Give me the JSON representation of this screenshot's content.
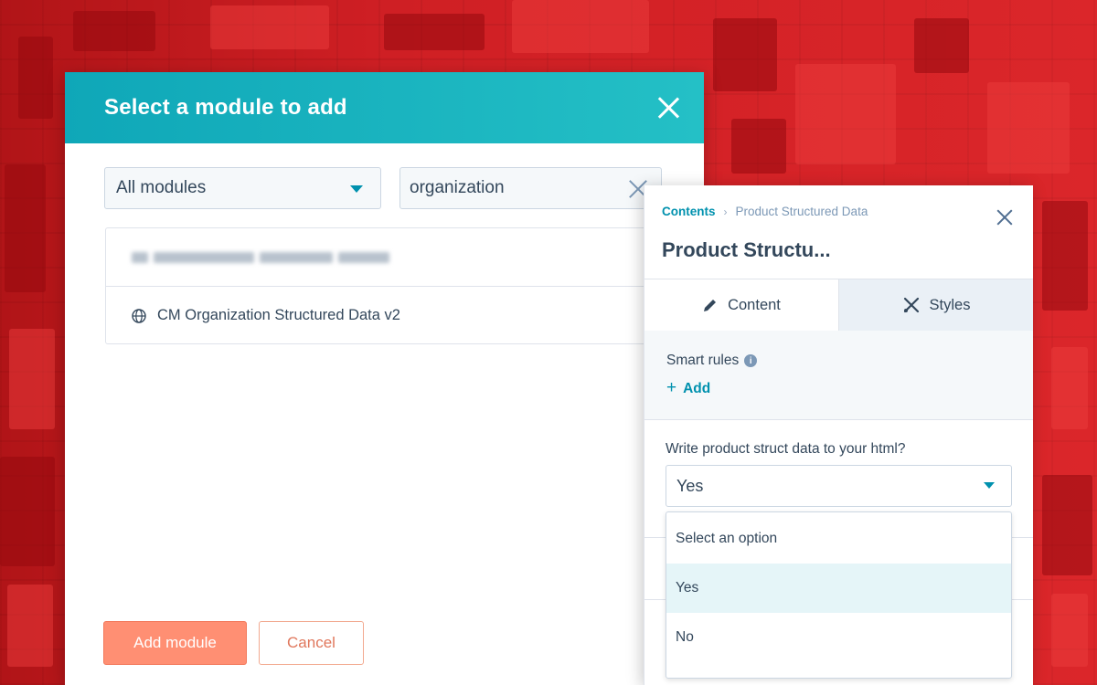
{
  "modal": {
    "title": "Select a module to add",
    "filter_value": "All modules",
    "search_value": "organization",
    "results": [
      {
        "label": "",
        "blurred": true
      },
      {
        "label": "CM Organization Structured Data v2",
        "icon": "globe-icon"
      }
    ],
    "add_button": "Add module",
    "cancel_button": "Cancel"
  },
  "panel": {
    "breadcrumb_root": "Contents",
    "breadcrumb_current": "Product Structured Data",
    "title": "Product Structu...",
    "tabs": [
      {
        "label": "Content",
        "icon": "pencil-icon",
        "active": true
      },
      {
        "label": "Styles",
        "icon": "styles-icon",
        "active": false
      }
    ],
    "smart_rules_label": "Smart rules",
    "add_label": "Add",
    "field_label": "Write product struct data to your html?",
    "field_value": "Yes",
    "options": [
      "Select an option",
      "Yes",
      "No"
    ],
    "highlighted_option": "Yes"
  },
  "colors": {
    "header_teal": "#0fa7b8",
    "accent_link": "#0091ae",
    "primary_button": "#ff8f73",
    "background_red": "#cf1f24"
  }
}
